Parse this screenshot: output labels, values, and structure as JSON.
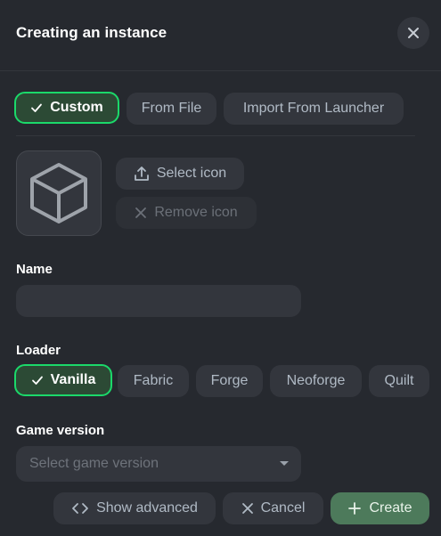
{
  "modal": {
    "title": "Creating an instance"
  },
  "source_tabs": [
    {
      "label": "Custom",
      "selected": true
    },
    {
      "label": "From File",
      "selected": false
    },
    {
      "label": "Import From Launcher",
      "selected": false
    }
  ],
  "icon_section": {
    "select_label": "Select icon",
    "remove_label": "Remove icon"
  },
  "name_field": {
    "label": "Name",
    "value": "",
    "placeholder": ""
  },
  "loader": {
    "label": "Loader",
    "options": [
      {
        "label": "Vanilla",
        "selected": true
      },
      {
        "label": "Fabric",
        "selected": false
      },
      {
        "label": "Forge",
        "selected": false
      },
      {
        "label": "Neoforge",
        "selected": false
      },
      {
        "label": "Quilt",
        "selected": false
      }
    ]
  },
  "game_version": {
    "label": "Game version",
    "placeholder": "Select game version"
  },
  "footer": {
    "show_advanced_label": "Show advanced",
    "cancel_label": "Cancel",
    "create_label": "Create"
  },
  "colors": {
    "background": "#26292f",
    "surface": "#33363d",
    "accent_green": "#1bd96a",
    "selected_bg": "#2c4a35",
    "create_bg": "#4d7a5b"
  }
}
